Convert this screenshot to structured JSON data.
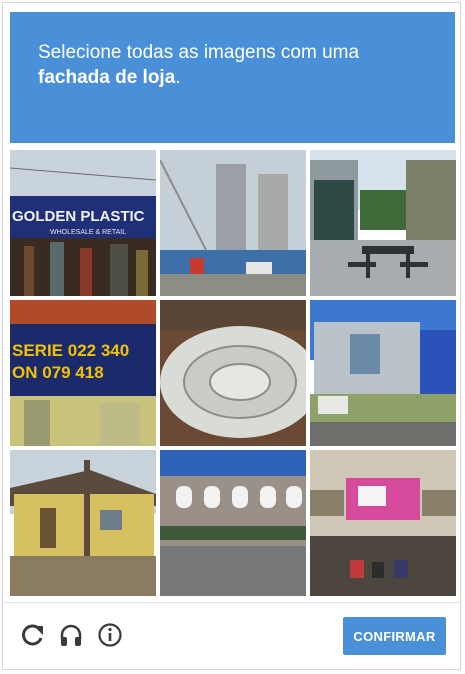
{
  "prompt": {
    "line1": "Selecione todas as imagens com uma",
    "line2_bold": "fachada de loja",
    "line2_end": "."
  },
  "tiles": [
    {
      "sign_text": "GOLDEN PLASTIC",
      "sign_subtext": "WHOLESALE & RETAIL"
    },
    {},
    {},
    {
      "sign_line1": "SERIE  022 340",
      "sign_line2": "ON   079 418"
    },
    {},
    {},
    {},
    {},
    {}
  ],
  "footer": {
    "confirm_label": "CONFIRMAR",
    "reload_icon": "reload-icon",
    "audio_icon": "headphones-icon",
    "info_icon": "info-icon"
  },
  "colors": {
    "accent": "#4a90d9",
    "icon": "#555555"
  }
}
